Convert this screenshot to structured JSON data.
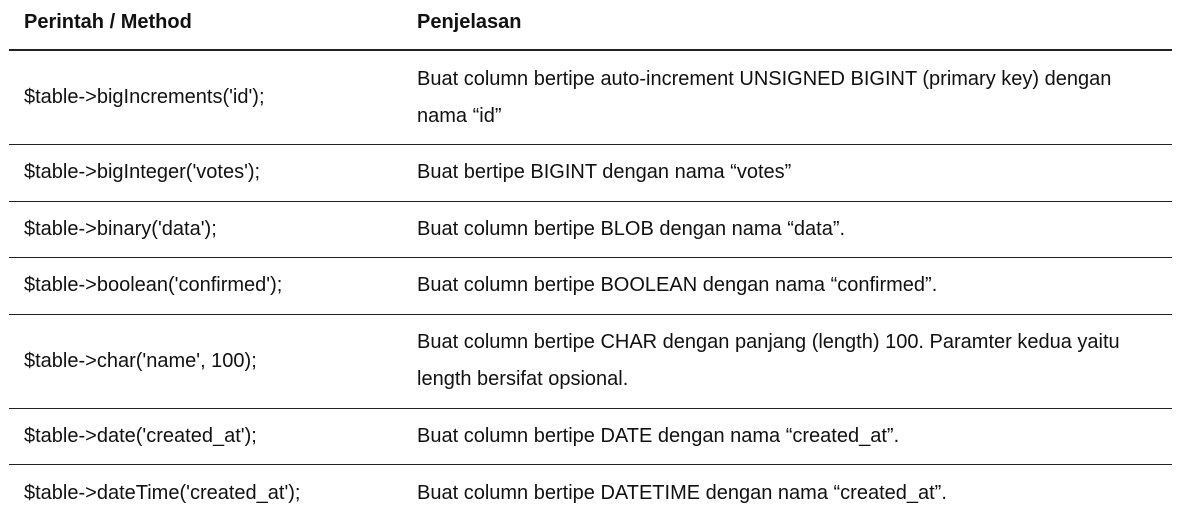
{
  "table": {
    "headers": {
      "method": "Perintah / Method",
      "description": "Penjelasan"
    },
    "rows": [
      {
        "method": "$table->bigIncrements('id');",
        "description": "Buat column bertipe auto-increment UNSIGNED BIGINT (primary key) dengan nama “id”"
      },
      {
        "method": "$table->bigInteger('votes');",
        "description": "Buat bertipe BIGINT dengan nama “votes”"
      },
      {
        "method": "$table->binary('data');",
        "description": "Buat column bertipe BLOB dengan nama “data”."
      },
      {
        "method": "$table->boolean('confirmed');",
        "description": "Buat column bertipe BOOLEAN dengan nama “confirmed”."
      },
      {
        "method": "$table->char('name', 100);",
        "description": "Buat column bertipe CHAR dengan panjang (length) 100. Paramter kedua yaitu length bersifat opsional."
      },
      {
        "method": "$table->date('created_at');",
        "description": "Buat column bertipe DATE dengan nama “created_at”."
      },
      {
        "method": "$table->dateTime('created_at');",
        "description": "Buat column bertipe DATETIME dengan nama “created_at”."
      }
    ]
  }
}
